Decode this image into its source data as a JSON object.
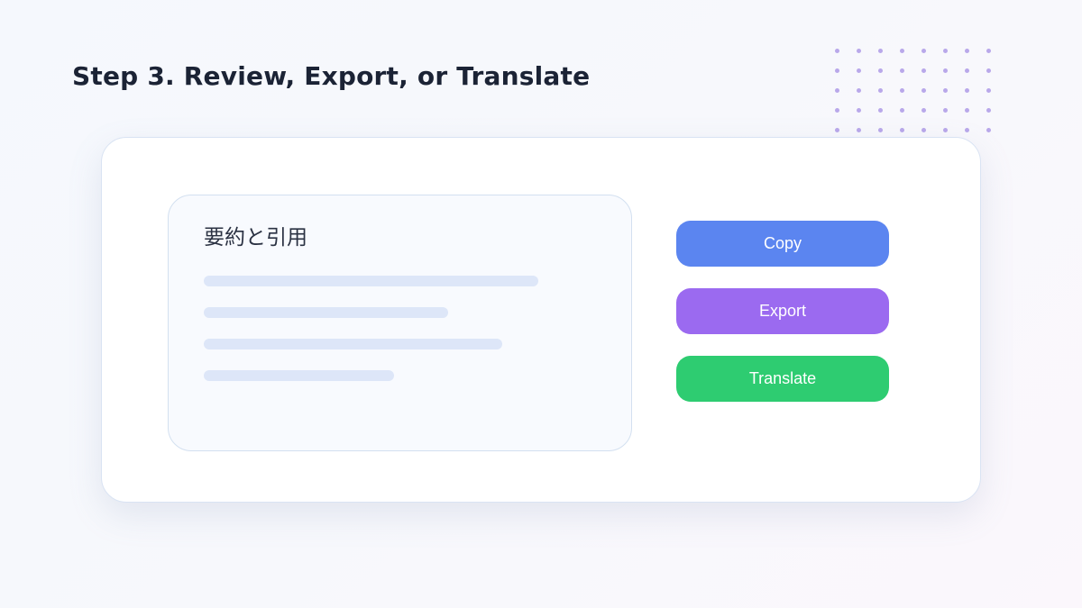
{
  "page": {
    "title": "Step 3. Review, Export, or Translate"
  },
  "summary_panel": {
    "title": "要約と引用",
    "placeholder_lines": 4
  },
  "actions": {
    "copy": {
      "label": "Copy",
      "color": "#5b85f0"
    },
    "export": {
      "label": "Export",
      "color": "#9b6af0"
    },
    "translate": {
      "label": "Translate",
      "color": "#2ecc71"
    }
  },
  "theme": {
    "dot_color": "#b9a8ea",
    "placeholder_color": "#dde6f8"
  }
}
